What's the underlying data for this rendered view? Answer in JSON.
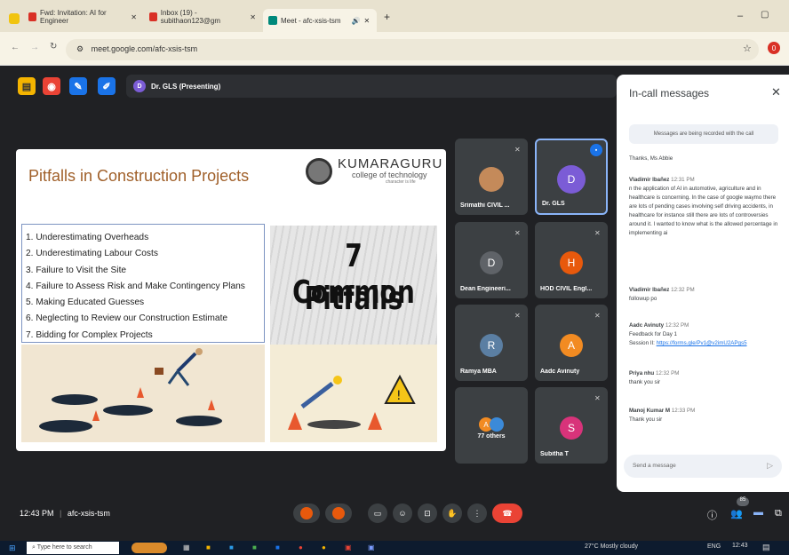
{
  "browser": {
    "tabs": [
      {
        "label": "Fwd: Invitation: AI for Engineer",
        "icon": "gmail-icon"
      },
      {
        "label": "Inbox (19) - subithaon123@gm",
        "icon": "gmail-icon"
      },
      {
        "label": "Meet - afc-xsis-tsm",
        "icon": "meet-icon"
      }
    ],
    "url": "meet.google.com/afc-xsis-tsm",
    "profile_initial": "0"
  },
  "meet": {
    "presenting_label": "Dr. GLS (Presenting)",
    "presenter_initial": "D",
    "time": "12:43 PM",
    "meeting_code": "afc-xsis-tsm",
    "people_count": "85"
  },
  "slide": {
    "title": "Pitfalls in Construction Projects",
    "logo_name": "KUMARAGURU",
    "logo_sub": "college of technology",
    "logo_tag": "character is life",
    "items": [
      "1. Underestimating Overheads",
      "2. Underestimating Labour Costs",
      "3. Failure to Visit the Site",
      "4. Failure to Assess Risk and Make Contingency Plans",
      "5. Making Educated Guesses",
      "6. Neglecting to Review our Construction Estimate",
      "7. Bidding for Complex Projects"
    ],
    "big_line1": "7 Common",
    "big_line2": "Pitfalls"
  },
  "participants": [
    {
      "name": "Srimathi CIVIL ...",
      "initial": "",
      "color": "#b07040"
    },
    {
      "name": "Dr. GLS",
      "initial": "D",
      "color": "#7b5cd6"
    },
    {
      "name": "Dean Engineeri...",
      "initial": "D",
      "color": "#5f6368"
    },
    {
      "name": "HOD CIVIL Engl...",
      "initial": "H",
      "color": "#e8590c"
    },
    {
      "name": "Ramya MBA",
      "initial": "R",
      "color": "#5b7fa3"
    },
    {
      "name": "Aadc Avinuty",
      "initial": "A",
      "color": "#f28b22"
    },
    {
      "name": "77 others",
      "initial": "A",
      "color": "#f28b22"
    },
    {
      "name": "Subitha T",
      "initial": "S",
      "color": "#d8337a"
    }
  ],
  "chat": {
    "title": "In-call messages",
    "notice": "Messages are being recorded with the call",
    "send_placeholder": "Send a message",
    "messages": [
      {
        "sender": "",
        "time": "",
        "text": "Thanks, Ms Abbie"
      },
      {
        "sender": "Vladimir Ibañez",
        "time": "12:31 PM",
        "text": "n the application of AI in automotive, agriculture and in healthcare is concerning. In the case of google waymo there are lots of pending cases involving self driving accidents, in healthcare for instance still there are lots of controversies around it. I wanted to know what is the allowed percentage in implementing ai"
      },
      {
        "sender": "Vladimir Ibañez",
        "time": "12:32 PM",
        "text": "followup po"
      },
      {
        "sender": "Aadc Avinuty",
        "time": "12:32 PM",
        "text": "Feedback for Day 1",
        "link_prefix": "Session II:",
        "link": "https://forms.gle/Pv1@v2imU2APgs5"
      },
      {
        "sender": "Priya nhu",
        "time": "12:32 PM",
        "text": "thank you sir"
      },
      {
        "sender": "Manoj Kumar M",
        "time": "12:33 PM",
        "text": "Thank you sir"
      }
    ]
  },
  "taskbar": {
    "search_placeholder": "Type here to search",
    "weather": "27°C  Mostly cloudy",
    "lang": "ENG",
    "clock": "12:43"
  }
}
